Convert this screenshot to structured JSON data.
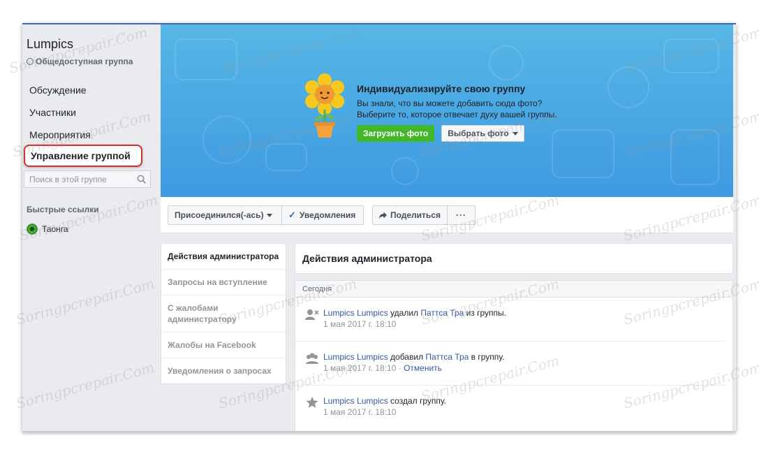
{
  "sidebar": {
    "group_name": "Lumpics",
    "group_type": "Общедоступная группа",
    "nav": [
      "Обсуждение",
      "Участники",
      "Мероприятия"
    ],
    "manage": "Управление группой",
    "search_placeholder": "Поиск в этой группе",
    "quick_links_title": "Быстрые ссылки",
    "quick_link": "Таонга"
  },
  "cover": {
    "promo_title": "Индивидуализируйте свою группу",
    "promo_text_1": "Вы знали, что вы можете добавить сюда фото?",
    "promo_text_2": "Выберите то, которое отвечает духу вашей группы.",
    "upload_label": "Загрузить фото",
    "choose_label": "Выбрать фото"
  },
  "actionbar": {
    "joined": "Присоединился(-ась)",
    "notifications": "Уведомления",
    "share": "Поделиться",
    "more": "···"
  },
  "admin_menu": [
    "Действия администратора",
    "Запросы на вступление",
    "С жалобами администратору",
    "Жалобы на Facebook",
    "Уведомления о запросах"
  ],
  "main": {
    "title": "Действия администратора",
    "date_header": "Сегодня",
    "entries": [
      {
        "actor": "Lumpics Lumpics",
        "verb": " удалил ",
        "target": "Паттса Тра",
        "tail": " из группы.",
        "time": "1 мая 2017 г. 18:10",
        "undo": ""
      },
      {
        "actor": "Lumpics Lumpics",
        "verb": " добавил ",
        "target": "Паттса Тра",
        "tail": " в группу.",
        "time": "1 мая 2017 г. 18:10 · ",
        "undo": "Отменить"
      },
      {
        "actor": "Lumpics Lumpics",
        "verb": " создал группу.",
        "target": "",
        "tail": "",
        "time": "1 мая 2017 г. 18:10",
        "undo": ""
      }
    ]
  },
  "watermark": "Soringpcrepair.Com",
  "colors": {
    "accent": "#4267b2",
    "green": "#42b72a",
    "highlight_border": "#d62d2d",
    "cover": "#4aa9e4"
  }
}
